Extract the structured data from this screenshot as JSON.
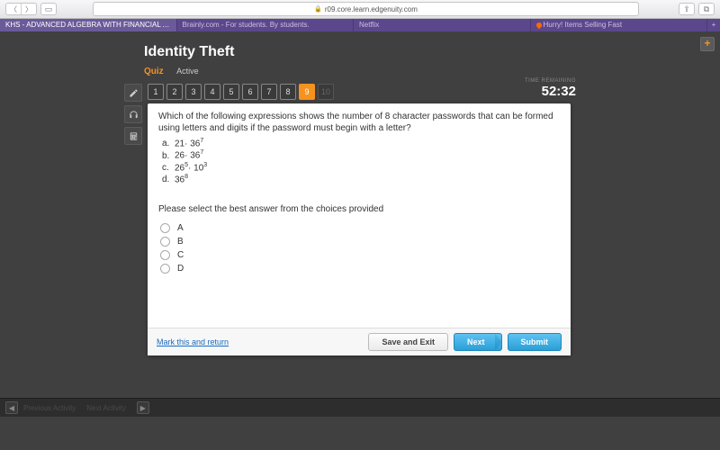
{
  "browser": {
    "url": "r09.core.learn.edgenuity.com",
    "tabs": [
      {
        "label": "KHS - ADVANCED ALGEBRA WITH FINANCIAL APPLICATIONS...",
        "active": true
      },
      {
        "label": "Brainly.com - For students. By students."
      },
      {
        "label": "Netflix"
      },
      {
        "label": "Hurry! Items Selling Fast",
        "flame": true
      }
    ]
  },
  "lesson": {
    "title": "Identity Theft",
    "type": "Quiz",
    "status": "Active"
  },
  "qnav": {
    "items": [
      "1",
      "2",
      "3",
      "4",
      "5",
      "6",
      "7",
      "8",
      "9",
      "10"
    ],
    "current": 8,
    "disabled": [
      9
    ]
  },
  "timer": {
    "label": "TIME REMAINING",
    "value": "52:32"
  },
  "question": {
    "text": "Which of the following expressions shows the number of 8 character passwords that can be formed using letters and digits if the password must begin with a letter?",
    "options": [
      {
        "letter": "a.",
        "base1": "21",
        "exp1": "",
        "op": "· ",
        "base2": "36",
        "exp2": "7"
      },
      {
        "letter": "b.",
        "base1": "26",
        "exp1": "",
        "op": "· ",
        "base2": "36",
        "exp2": "7"
      },
      {
        "letter": "c.",
        "base1": "26",
        "exp1": "5",
        "op": "· ",
        "base2": "10",
        "exp2": "3"
      },
      {
        "letter": "d.",
        "base1": "36",
        "exp1": "8",
        "op": "",
        "base2": "",
        "exp2": ""
      }
    ],
    "instruction": "Please select the best answer from the choices provided",
    "choices": [
      "A",
      "B",
      "C",
      "D"
    ]
  },
  "footer": {
    "mark": "Mark this and return",
    "save": "Save and Exit",
    "next": "Next",
    "submit": "Submit"
  },
  "bottom": {
    "prev": "Previous Activity",
    "next": "Next Activity"
  }
}
